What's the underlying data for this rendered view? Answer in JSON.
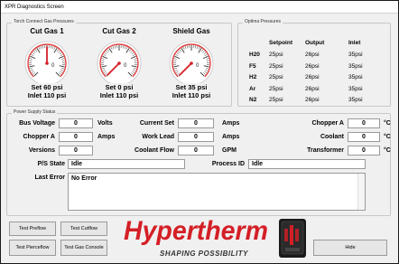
{
  "window": {
    "title": "XPR Diagnostics Screen"
  },
  "torch_gas": {
    "group_label": "Torch Connect Gas Pressures",
    "gauges": [
      {
        "title": "Cut Gas 1",
        "set": "Set 60 psi",
        "inlet": "Inlet 110 psi",
        "level": 0.5
      },
      {
        "title": "Cut Gas 2",
        "set": "Set 0 psi",
        "inlet": "Inlet 110 psi",
        "level": 0.0
      },
      {
        "title": "Shield Gas",
        "set": "Set 35 psi",
        "inlet": "Inlet 110 psi",
        "level": 0.0
      }
    ]
  },
  "optima": {
    "group_label": "Optima Pressures",
    "headers": {
      "setpoint": "Setpoint",
      "output": "Output",
      "inlet": "Inlet"
    },
    "rows": [
      {
        "gas": "H20",
        "setpoint": "25psi",
        "output": "26psi",
        "inlet": "35psi"
      },
      {
        "gas": "F5",
        "setpoint": "25psi",
        "output": "26psi",
        "inlet": "35psi"
      },
      {
        "gas": "H2",
        "setpoint": "25psi",
        "output": "26psi",
        "inlet": "35psi"
      },
      {
        "gas": "Ar",
        "setpoint": "25psi",
        "output": "26psi",
        "inlet": "35psi"
      },
      {
        "gas": "N2",
        "setpoint": "25psi",
        "output": "26psi",
        "inlet": "35psi"
      }
    ]
  },
  "status": {
    "group_label": "Power Supply Status",
    "bus_voltage": {
      "label": "Bus Voltage",
      "value": "0",
      "unit": "Volts"
    },
    "chopper_a_left": {
      "label": "Chopper A",
      "value": "0",
      "unit": "Amps"
    },
    "versions": {
      "label": "Versions",
      "value": "0"
    },
    "current_set": {
      "label": "Current Set",
      "value": "0",
      "unit": "Amps"
    },
    "work_lead": {
      "label": "Work Lead",
      "value": "0",
      "unit": "Amps"
    },
    "coolant_flow": {
      "label": "Coolant Flow",
      "value": "0",
      "unit": "GPM"
    },
    "chopper_a_right": {
      "label": "Chopper A",
      "value": "0",
      "unit": "°C"
    },
    "coolant": {
      "label": "Coolant",
      "value": "0",
      "unit": "°C"
    },
    "transformer": {
      "label": "Transformer",
      "value": "0",
      "unit": "°C"
    },
    "ps_state": {
      "label": "P/S State",
      "value": "Idle"
    },
    "process_id": {
      "label": "Process ID",
      "value": "Idle"
    },
    "last_error": {
      "label": "Last Error",
      "value": "No Error"
    }
  },
  "buttons": {
    "test_preflow": "Test Preflow",
    "test_cutflow": "Test Cutflow",
    "test_pierceflow": "Test Pierceflow",
    "test_gas_console": "Test Gas Console",
    "hide": "Hide"
  },
  "brand": {
    "logo": "Hypertherm",
    "tagline": "SHAPING POSSIBILITY",
    "logo_color": "#d41f26"
  }
}
